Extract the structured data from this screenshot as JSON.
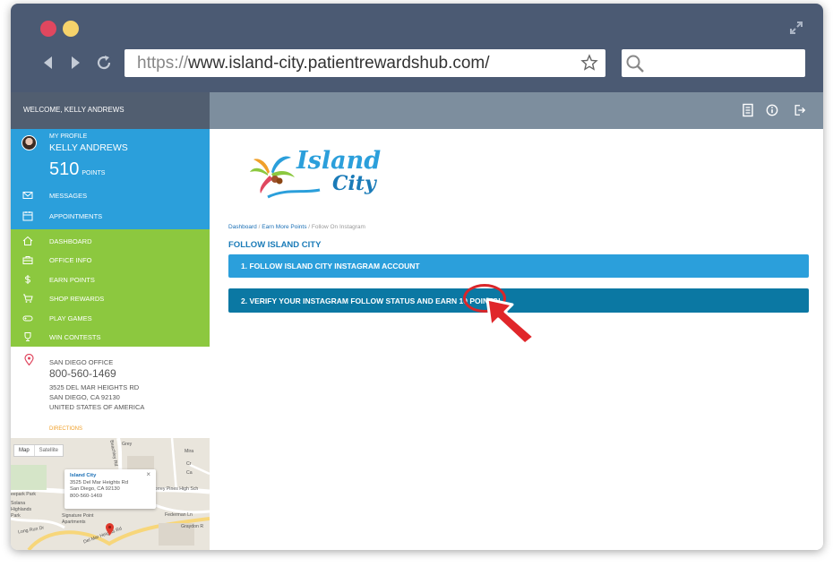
{
  "browser": {
    "url_protocol": "https://",
    "url_host": "www.island-city.patientrewardshub.com/",
    "icons": [
      "expand-icon",
      "back-icon",
      "forward-icon",
      "reload-icon",
      "star-icon",
      "search-icon"
    ]
  },
  "sidebar": {
    "welcome": "WELCOME, KELLY ANDREWS",
    "my_profile": "MY PROFILE",
    "name": "KELLY ANDREWS",
    "points_value": "510",
    "points_label": "POINTS",
    "blue_items": [
      {
        "label": "MESSAGES",
        "icon": "envelope-icon"
      },
      {
        "label": "APPOINTMENTS",
        "icon": "calendar-icon"
      }
    ],
    "green_items": [
      {
        "label": "DASHBOARD",
        "icon": "home-icon"
      },
      {
        "label": "OFFICE INFO",
        "icon": "briefcase-icon"
      },
      {
        "label": "EARN POINTS",
        "icon": "dollar-icon"
      },
      {
        "label": "SHOP REWARDS",
        "icon": "cart-icon"
      },
      {
        "label": "PLAY GAMES",
        "icon": "gamepad-icon"
      },
      {
        "label": "WIN CONTESTS",
        "icon": "trophy-icon"
      }
    ],
    "office": {
      "name": "SAN DIEGO OFFICE",
      "phone": "800-560-1469",
      "address1": "3525 DEL MAR HEIGHTS RD",
      "address2": "SAN DIEGO, CA 92130",
      "country": "UNITED STATES OF AMERICA",
      "directions": "DIRECTIONS"
    },
    "map": {
      "tab_map": "Map",
      "tab_satellite": "Satellite",
      "card_name": "Island City",
      "card_addr1": "3525 Del Mar Heights Rd",
      "card_addr2": "San Diego, CA 92130",
      "card_phone": "800-560-1469",
      "card_close": "×",
      "labels": [
        "Torrey Pines High Sch",
        "Federman Ln",
        "Graydon R",
        "Signature Point",
        "Apartments",
        "Del Mar Heights Rd",
        "eepark Park",
        "Solana",
        "Highlands",
        "Park",
        "Long Run Dr",
        "Beachley Rd",
        "Grey",
        "Mira",
        "Cr",
        "Ca"
      ]
    }
  },
  "topbar": {
    "icons": [
      "document-icon",
      "info-icon",
      "logout-icon"
    ]
  },
  "main": {
    "logo_text_top": "Island",
    "logo_text_bottom": "City",
    "breadcrumb": {
      "dashboard": "Dashboard",
      "earn": "Earn More Points",
      "current": "Follow On Instagram",
      "sep": "/"
    },
    "title": "FOLLOW ISLAND CITY",
    "step1": "1. FOLLOW ISLAND CITY INSTAGRAM ACCOUNT",
    "step2": "2. VERIFY YOUR INSTAGRAM FOLLOW STATUS AND EARN 10 POINTS!"
  },
  "colors": {
    "chrome": "#4b5a73",
    "sidebar_blue": "#2b9fdb",
    "sidebar_green": "#8cc83f",
    "step1_bar": "#2b9fdb",
    "step2_bar": "#0b78a3",
    "cursor": "#e0262a"
  }
}
